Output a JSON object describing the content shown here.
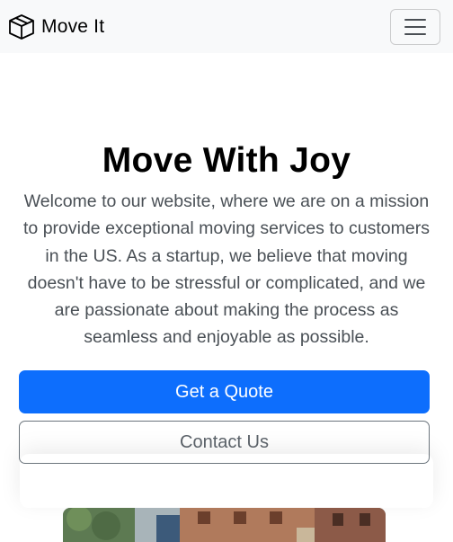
{
  "navbar": {
    "brand_label": "Move It",
    "brand_icon": "box-icon",
    "toggler_icon": "hamburger-menu-icon"
  },
  "hero": {
    "title": "Move With Joy",
    "lead": "Welcome to our website, where we are on a mission to provide exceptional moving services to customers in the US. As a startup, we believe that moving doesn't have to be stressful or complicated, and we are passionate about making the process as seamless and enjoyable as possible.",
    "primary_button": "Get a Quote",
    "secondary_button": "Contact Us"
  },
  "colors": {
    "primary": "#0d6efd",
    "navbar_bg": "#f8f9fa",
    "outline": "#6c757d"
  }
}
